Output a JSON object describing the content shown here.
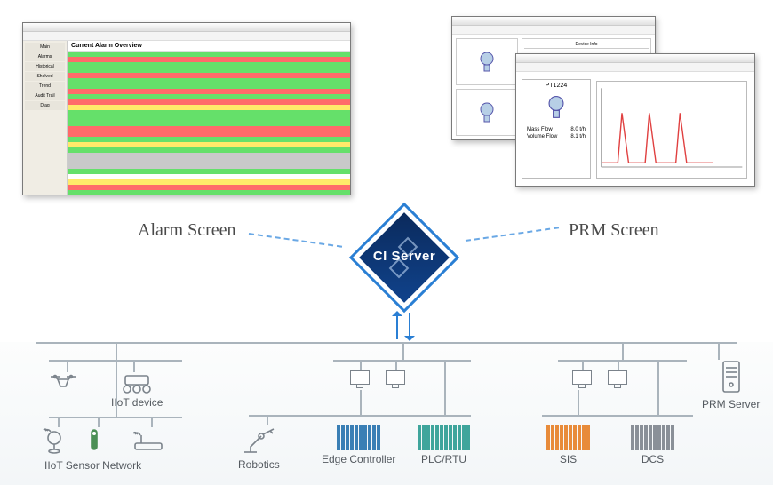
{
  "labels": {
    "alarm_screen": "Alarm Screen",
    "prm_screen": "PRM Screen",
    "ci_server": "CI Server"
  },
  "alarm_window": {
    "title": "Current Alarm Overview",
    "sidebar": [
      "Main",
      "Alarms",
      "Historical",
      "Shelved",
      "Trend",
      "Audit Trail",
      "Diag"
    ],
    "row_pattern": [
      "green",
      "red",
      "green",
      "green",
      "red",
      "green",
      "green",
      "red",
      "green",
      "red",
      "yel",
      "green",
      "green",
      "green",
      "red",
      "red",
      "green",
      "yel",
      "green",
      "gray",
      "gray",
      "gray",
      "green",
      "white",
      "yel",
      "red",
      "green",
      "green"
    ]
  },
  "prm_window": {
    "section_title": "Device Info",
    "device_id": "PT1224",
    "readings": [
      {
        "label": "Mass Flow",
        "value": "8.0",
        "unit": "t/h"
      },
      {
        "label": "Volume Flow",
        "value": "8.1",
        "unit": "t/h"
      }
    ]
  },
  "network": {
    "left_group": {
      "iiot_device": "IIoT device",
      "iiot_sensor_network": "IIoT Sensor Network"
    },
    "center_group": {
      "robotics": "Robotics",
      "edge_controller": "Edge Controller",
      "plc_rtu": "PLC/RTU"
    },
    "right_group": {
      "sis": "SIS",
      "dcs": "DCS",
      "prm_server": "PRM Server"
    }
  },
  "colors": {
    "accent_blue": "#2a7fd4",
    "ci_dark": "#0b2a5c",
    "bus_gray": "#aab4bc",
    "rack_blue": "#3a7fb5",
    "rack_teal": "#3fa59c",
    "rack_orange": "#e88b3a"
  }
}
